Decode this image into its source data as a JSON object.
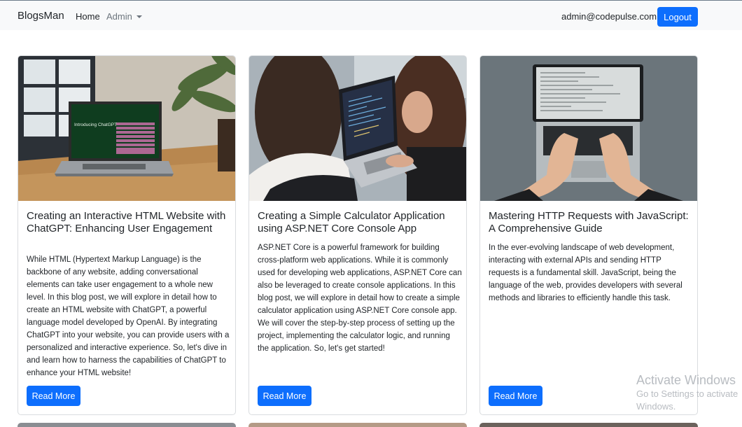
{
  "navbar": {
    "brand": "BlogsMan",
    "home": "Home",
    "admin": "Admin",
    "user_email": "admin@codepulse.com",
    "logout": "Logout"
  },
  "posts": [
    {
      "title": "Creating an Interactive HTML Website with ChatGPT: Enhancing User Engagement",
      "summary": "While HTML (Hypertext Markup Language) is the backbone of any website, adding conversational elements can take user engagement to a whole new level. In this blog post, we will explore in detail how to create an HTML website with ChatGPT, a powerful language model developed by OpenAI. By integrating ChatGPT into your website, you can provide users with a personalized and interactive experience. So, let's dive in and learn how to harness the capabilities of ChatGPT to enhance your HTML website!",
      "image_text": "Introducing ChatGPT",
      "read_more": "Read More"
    },
    {
      "title": "Creating a Simple Calculator Application using ASP.NET Core Console App",
      "summary": "ASP.NET Core is a powerful framework for building cross-platform web applications. While it is commonly used for developing web applications, ASP.NET Core can also be leveraged to create console applications. In this blog post, we will explore in detail how to create a simple calculator application using ASP.NET Core console app. We will cover the step-by-step process of setting up the project, implementing the calculator logic, and running the application. So, let's get started!",
      "read_more": "Read More"
    },
    {
      "title": "Mastering HTTP Requests with JavaScript: A Comprehensive Guide",
      "summary": "In the ever-evolving landscape of web development, interacting with external APIs and sending HTTP requests is a fundamental skill. JavaScript, being the language of the web, provides developers with several methods and libraries to efficiently handle this task.",
      "read_more": "Read More"
    }
  ],
  "watermark": {
    "line1": "Activate Windows",
    "line2": "Go to Settings to activate Windows."
  },
  "colors": {
    "primary": "#0d6efd",
    "navbar_bg": "#f8f9fa",
    "muted": "#6c757d"
  }
}
